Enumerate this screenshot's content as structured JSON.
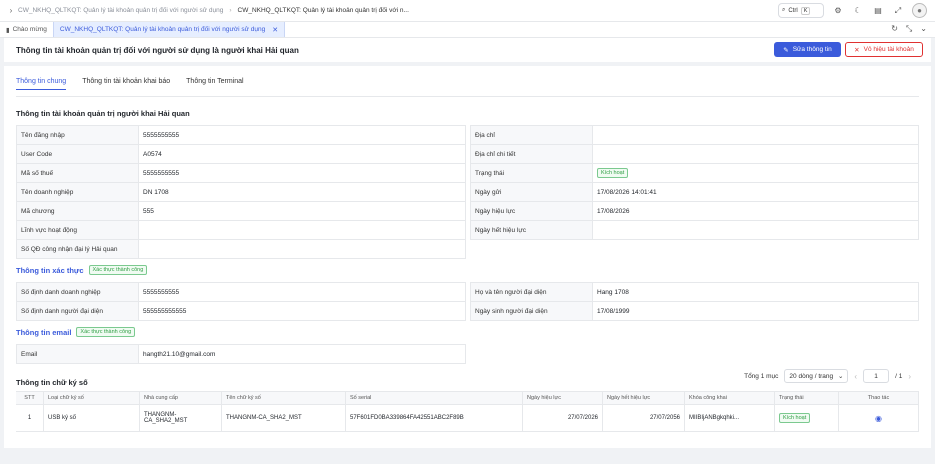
{
  "topbar": {
    "breadcrumb": [
      "CW_NKHQ_QLTKQT: Quản lý tài khoản quản trị đối với người sử dụng",
      "CW_NKHQ_QLTKQT: Quản lý tài khoản quản trị đối với n..."
    ],
    "search_label": "Ctrl",
    "search_key": "K"
  },
  "tabs": [
    {
      "label": "Chào mừng"
    },
    {
      "label": "CW_NKHQ_QLTKQT: Quản lý tài khoản quản trị đối với người sử dụng"
    }
  ],
  "header": {
    "title": "Thông tin tài khoản quản trị đối với người sử dụng là người khai Hải quan",
    "edit_label": "Sửa thông tin",
    "disable_label": "Vô hiệu tài khoản"
  },
  "subtabs": [
    "Thông tin chung",
    "Thông tin tài khoản khai báo",
    "Thông tin Terminal"
  ],
  "section_account": {
    "title": "Thông tin tài khoản quản trị người khai Hải quan",
    "left": [
      {
        "label": "Tên đăng nhập",
        "value": "5555555555"
      },
      {
        "label": "User Code",
        "value": "A0574"
      },
      {
        "label": "Mã số thuế",
        "value": "5555555555"
      },
      {
        "label": "Tên doanh nghiệp",
        "value": "DN 1708"
      },
      {
        "label": "Mã chương",
        "value": "555"
      },
      {
        "label": "Lĩnh vực hoạt động",
        "value": ""
      },
      {
        "label": "Số QĐ công nhận đại lý Hải quan",
        "value": ""
      }
    ],
    "right": [
      {
        "label": "Địa chỉ",
        "value": ""
      },
      {
        "label": "Địa chỉ chi tiết",
        "value": ""
      },
      {
        "label": "Trạng thái",
        "value": "Kích hoạt"
      },
      {
        "label": "Ngày gửi",
        "value": "17/08/2026 14:01:41"
      },
      {
        "label": "Ngày hiệu lực",
        "value": "17/08/2026"
      },
      {
        "label": "Ngày hết hiệu lực",
        "value": ""
      }
    ]
  },
  "section_verify": {
    "title": "Thông tin xác thực",
    "badge": "Xác thực thành công",
    "left": [
      {
        "label": "Số định danh doanh nghiệp",
        "value": "5555555555"
      },
      {
        "label": "Số định danh người đại diện",
        "value": "555555555555"
      }
    ],
    "right": [
      {
        "label": "Họ và tên người đại diện",
        "value": "Hang 1708"
      },
      {
        "label": "Ngày sinh người đại diện",
        "value": "17/08/1999"
      }
    ]
  },
  "section_email": {
    "title": "Thông tin email",
    "badge": "Xác thực thành công",
    "rows": [
      {
        "label": "Email",
        "value": "hangth21.10@gmail.com"
      }
    ]
  },
  "section_sign": {
    "title": "Thông tin chữ ký số",
    "total": "Tổng 1 mục",
    "page_size": "20 dòng / trang",
    "page": "1",
    "page_total": "/ 1",
    "columns": [
      "STT",
      "Loại chữ ký số",
      "Nhà cung cấp",
      "Tên chữ ký số",
      "Số serial",
      "Ngày hiệu lực",
      "Ngày hết hiệu lực",
      "Khóa công khai",
      "Trạng thái",
      "Thao tác"
    ],
    "rows": [
      {
        "stt": "1",
        "loai": "USB ký số",
        "ncc": "THANGNM-CA_SHA2_MST",
        "ten": "THANGNM-CA_SHA2_MST",
        "serial": "57F601FD0BA339864FA42551ABC2F89B",
        "nhl": "27/07/2026",
        "nhhl": "27/07/2056",
        "khoa": "MIIBIjANBgkqhki...",
        "tt": "Kích hoạt"
      }
    ]
  }
}
